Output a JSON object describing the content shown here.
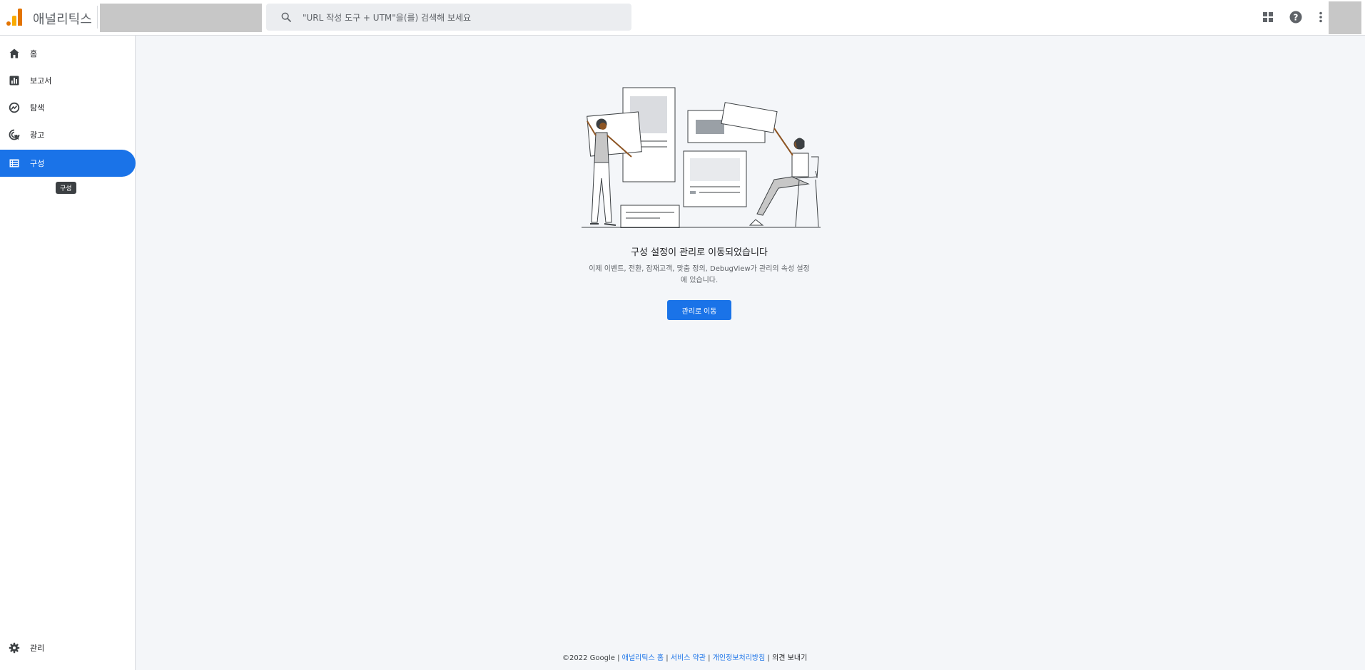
{
  "header": {
    "app_title": "애널리틱스",
    "search_placeholder": "\"URL 작성 도구 + UTM\"을(를) 검색해 보세요",
    "icons": [
      "apps-icon",
      "help-icon",
      "more-vert-icon"
    ]
  },
  "sidebar": {
    "items": [
      {
        "label": "홈",
        "icon": "home-icon"
      },
      {
        "label": "보고서",
        "icon": "reports-icon"
      },
      {
        "label": "탐색",
        "icon": "explore-icon"
      },
      {
        "label": "광고",
        "icon": "advertising-icon"
      },
      {
        "label": "구성",
        "icon": "configure-icon",
        "active": true
      }
    ],
    "tooltip": "구성",
    "admin_label": "관리"
  },
  "main": {
    "heading": "구성 설정이 관리로 이동되었습니다",
    "description": "이제 이벤트, 전환, 잠재고객, 맞춤 정의, DebugView가 관리의 속성 설정에 있습니다.",
    "button_label": "관리로 이동"
  },
  "footer": {
    "copyright": "©2022 Google",
    "sep": "|",
    "links": [
      "애널리틱스 홈",
      "서비스 약관",
      "개인정보처리방침"
    ],
    "feedback": "의견 보내기"
  },
  "colors": {
    "accent": "#1a73e8",
    "logo_orange": "#f9ab00",
    "logo_dark_orange": "#e37400"
  }
}
